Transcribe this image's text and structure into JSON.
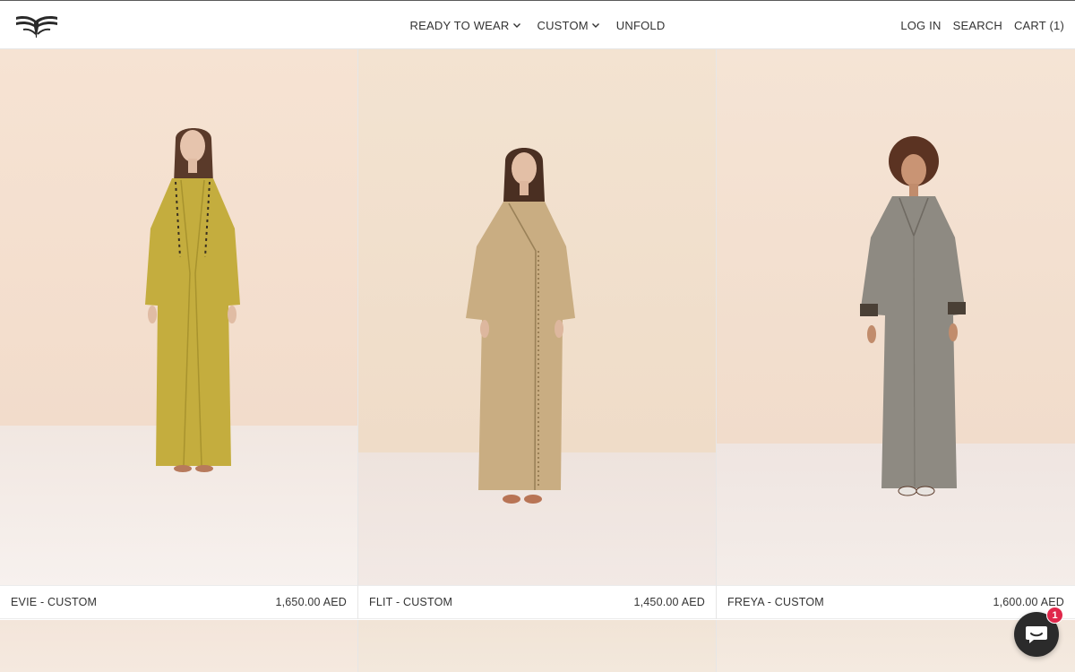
{
  "header": {
    "nav": [
      {
        "label": "READY TO WEAR",
        "has_dropdown": true
      },
      {
        "label": "CUSTOM",
        "has_dropdown": true
      },
      {
        "label": "UNFOLD",
        "has_dropdown": false
      }
    ],
    "login_label": "LOG IN",
    "search_label": "SEARCH",
    "cart_label": "CART (1)"
  },
  "products": [
    {
      "name": "EVIE - CUSTOM",
      "price": "1,650.00 AED",
      "garment_color": "#c4ad3e",
      "wall_color": "#f4dfcd",
      "floor_color": "#f3ebe5"
    },
    {
      "name": "FLIT - CUSTOM",
      "price": "1,450.00 AED",
      "garment_color": "#c9ad82",
      "wall_color": "#f2e2d0",
      "floor_color": "#f0e6e0"
    },
    {
      "name": "FREYA - CUSTOM",
      "price": "1,600.00 AED",
      "garment_color": "#8e8a82",
      "wall_color": "#f4e3d4",
      "floor_color": "#f1e9e5"
    }
  ],
  "chat": {
    "badge_count": "1"
  },
  "icons": {
    "logo": "brand-logo-icon",
    "dropdown": "chevron-down-icon",
    "chat": "chat-bubble-icon"
  },
  "colors": {
    "text": "#333333",
    "badge": "#e0284b",
    "chat_button": "#2b2b2b"
  }
}
